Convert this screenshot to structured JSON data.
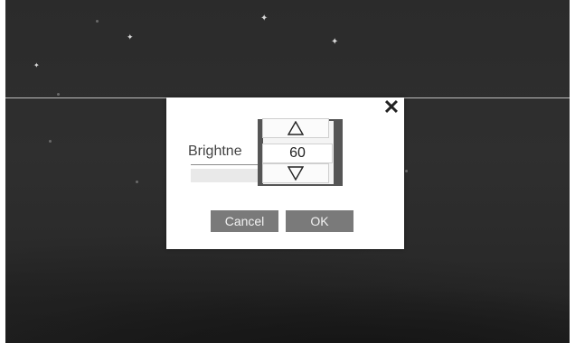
{
  "dialog": {
    "label": "Brightne",
    "value": "60",
    "cancel_label": "Cancel",
    "ok_label": "OK",
    "close_symbol": "✕"
  },
  "icons": {
    "close": "close-icon",
    "increment": "triangle-up-outline-icon",
    "decrement": "triangle-down-outline-icon"
  },
  "colors": {
    "background": "#2c2c2c",
    "dialog_bg": "#ffffff",
    "button_bg": "#7a7a7a",
    "spin_frame": "#555555"
  }
}
